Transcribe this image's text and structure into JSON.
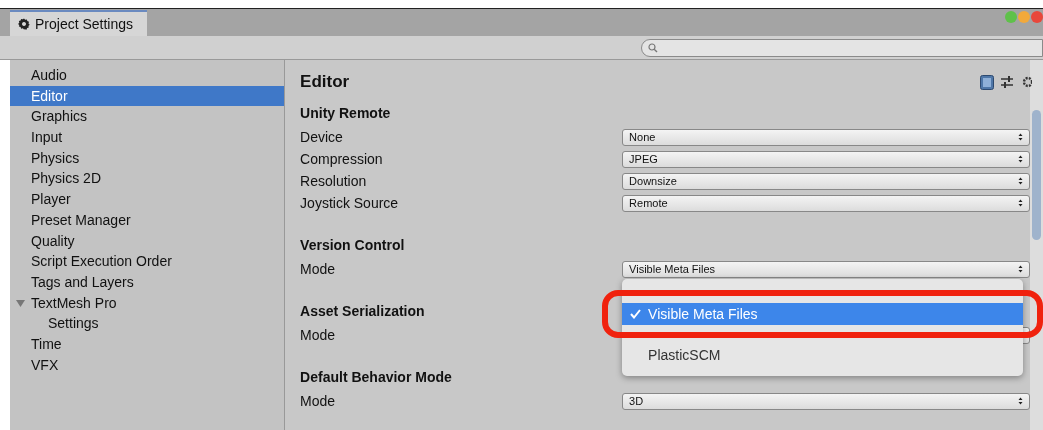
{
  "window": {
    "tab": {
      "label": "Project Settings",
      "selected": true
    }
  },
  "sidebar": {
    "items": [
      {
        "label": "Audio",
        "selected": false
      },
      {
        "label": "Editor",
        "selected": true
      },
      {
        "label": "Graphics",
        "selected": false
      },
      {
        "label": "Input",
        "selected": false
      },
      {
        "label": "Physics",
        "selected": false
      },
      {
        "label": "Physics 2D",
        "selected": false
      },
      {
        "label": "Player",
        "selected": false
      },
      {
        "label": "Preset Manager",
        "selected": false
      },
      {
        "label": "Quality",
        "selected": false
      },
      {
        "label": "Script Execution Order",
        "selected": false
      },
      {
        "label": "Tags and Layers",
        "selected": false
      },
      {
        "label": "TextMesh Pro",
        "selected": false,
        "expanded": true,
        "children": [
          {
            "label": "Settings",
            "selected": false
          }
        ]
      },
      {
        "label": "Time",
        "selected": false
      },
      {
        "label": "VFX",
        "selected": false
      }
    ]
  },
  "panel": {
    "title": "Editor",
    "sections": [
      {
        "header": "Unity Remote",
        "rows": [
          {
            "label": "Device",
            "value": "None"
          },
          {
            "label": "Compression",
            "value": "JPEG"
          },
          {
            "label": "Resolution",
            "value": "Downsize"
          },
          {
            "label": "Joystick Source",
            "value": "Remote"
          }
        ]
      },
      {
        "header": "Version Control",
        "rows": [
          {
            "label": "Mode",
            "value": "Visible Meta Files"
          }
        ]
      },
      {
        "header": "Asset Serialization",
        "rows": [
          {
            "label": "Mode"
          }
        ]
      },
      {
        "header": "Default Behavior Mode",
        "rows": [
          {
            "label": "Mode",
            "value": "3D"
          }
        ]
      }
    ]
  },
  "popup": {
    "items": [
      {
        "label": "Visible Meta Files",
        "selected": true,
        "highlighted": true
      },
      {
        "label": "PlasticSCM",
        "selected": false,
        "highlighted": false
      }
    ]
  }
}
